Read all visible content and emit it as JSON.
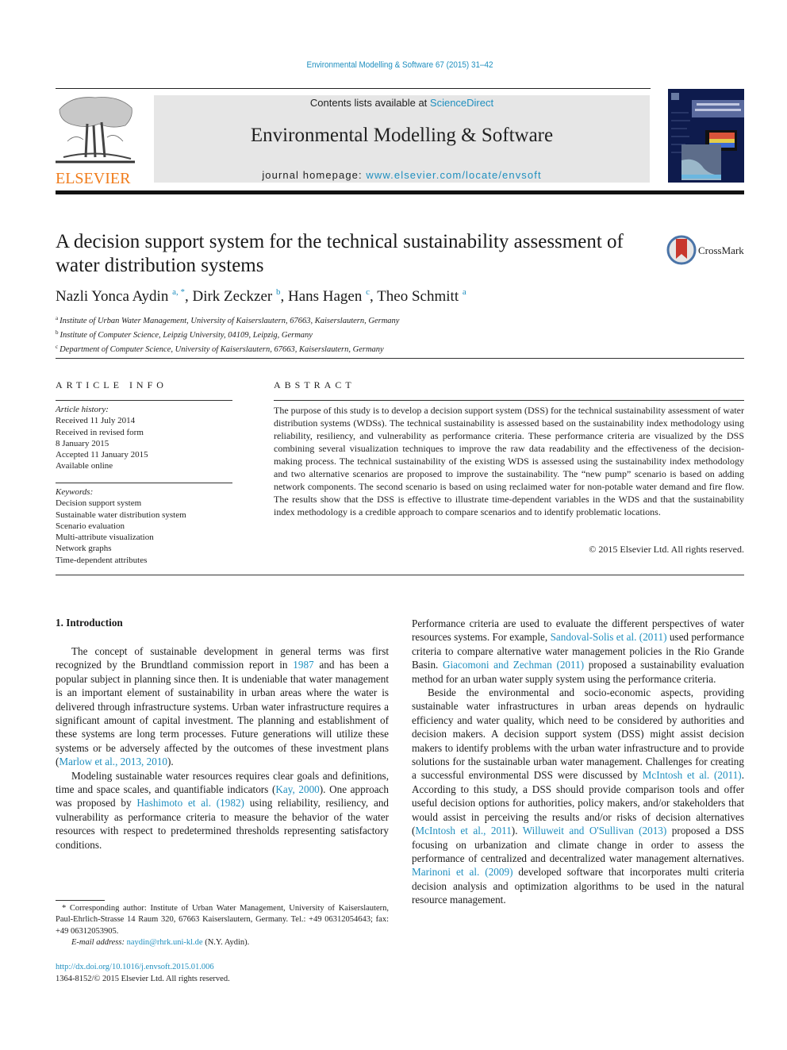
{
  "header": {
    "running_head": "Environmental Modelling & Software 67 (2015) 31–42",
    "publisher": "ELSEVIER",
    "contents_prefix": "Contents lists available at ",
    "contents_link": "ScienceDirect",
    "journal_title": "Environmental Modelling & Software",
    "homepage_prefix": "journal homepage: ",
    "homepage_link": "www.elsevier.com/locate/envsoft",
    "cover_title": "Environmental Modelling & Software",
    "colors": {
      "link": "#1f8fbf",
      "elsevier_orange": "#f07c1b",
      "banner_bg": "#e6e6e6",
      "cover_bg": "#0e1b4d"
    }
  },
  "article": {
    "title": "A decision support system for the technical sustainability assessment of water distribution systems",
    "crossmark_label": "CrossMark",
    "authors": [
      {
        "name": "Nazli Yonca Aydin",
        "sup": "a, *",
        "sep": ", "
      },
      {
        "name": "Dirk Zeckzer",
        "sup": "b",
        "sep": ", "
      },
      {
        "name": "Hans Hagen",
        "sup": "c",
        "sep": ", "
      },
      {
        "name": "Theo Schmitt",
        "sup": "a",
        "sep": ""
      }
    ],
    "affiliations": [
      {
        "key": "a",
        "text": "Institute of Urban Water Management, University of Kaiserslautern, 67663, Kaiserslautern, Germany"
      },
      {
        "key": "b",
        "text": "Institute of Computer Science, Leipzig University, 04109, Leipzig, Germany"
      },
      {
        "key": "c",
        "text": "Department of Computer Science, University of Kaiserslautern, 67663, Kaiserslautern, Germany"
      }
    ]
  },
  "article_info": {
    "heading": "ARTICLE INFO",
    "history_label": "Article history:",
    "history": [
      "Received 11 July 2014",
      "Received in revised form",
      "8 January 2015",
      "Accepted 11 January 2015",
      "Available online"
    ],
    "keywords_label": "Keywords:",
    "keywords": [
      "Decision support system",
      "Sustainable water distribution system",
      "Scenario evaluation",
      "Multi-attribute visualization",
      "Network graphs",
      "Time-dependent attributes"
    ]
  },
  "abstract": {
    "heading": "ABSTRACT",
    "text": "The purpose of this study is to develop a decision support system (DSS) for the technical sustainability assessment of water distribution systems (WDSs). The technical sustainability is assessed based on the sustainability index methodology using reliability, resiliency, and vulnerability as performance criteria. These performance criteria are visualized by the DSS combining several visualization techniques to improve the raw data readability and the effectiveness of the decision-making process. The technical sustainability of the existing WDS is assessed using the sustainability index methodology and two alternative scenarios are proposed to improve the sustainability. The “new pump” scenario is based on adding network components. The second scenario is based on using reclaimed water for non-potable water demand and fire flow. The results show that the DSS is effective to illustrate time-dependent variables in the WDS and that the sustainability index methodology is a credible approach to compare scenarios and to identify problematic locations.",
    "copyright": "© 2015 Elsevier Ltd. All rights reserved."
  },
  "body": {
    "section_heading": "1.  Introduction",
    "left_p1": {
      "t1": "The concept of sustainable development in general terms was first recognized by the Brundtland commission report in ",
      "l1": "1987",
      "t2": " and has been a popular subject in planning since then. It is undeniable that water management is an important element of sustainability in urban areas where the water is delivered through infrastructure systems. Urban water infrastructure requires a significant amount of capital investment. The planning and establishment of these systems are long term processes. Future generations will utilize these systems or be adversely affected by the outcomes of these investment plans (",
      "l2": "Marlow et al., 2013, 2010",
      "t3": ")."
    },
    "left_p2": {
      "t1": "Modeling sustainable water resources requires clear goals and definitions, time and space scales, and quantifiable indicators (",
      "l1": "Kay, 2000",
      "t2": "). One approach was proposed by ",
      "l2": "Hashimoto et al. (1982)",
      "t3": " using reliability, resiliency, and vulnerability as performance criteria to measure the behavior of the water resources with respect to predetermined thresholds representing satisfactory conditions."
    },
    "right_p1": {
      "t1": "Performance criteria are used to evaluate the different perspectives of water resources systems. For example, ",
      "l1": "Sandoval-Solis et al. (2011)",
      "t2": " used performance criteria to compare alternative water management policies in the Rio Grande Basin. ",
      "l2": "Giacomoni and Zechman (2011)",
      "t3": " proposed a sustainability evaluation method for an urban water supply system using the performance criteria."
    },
    "right_p2": {
      "t1": "Beside the environmental and socio-economic aspects, providing sustainable water infrastructures in urban areas depends on hydraulic efficiency and water quality, which need to be considered by authorities and decision makers. A decision support system (DSS) might assist decision makers to identify problems with the urban water infrastructure and to provide solutions for the sustainable urban water management. Challenges for creating a successful environmental DSS were discussed by ",
      "l1": "McIntosh et al. (2011)",
      "t2": ". According to this study, a DSS should provide comparison tools and offer useful decision options for authorities, policy makers, and/or stakeholders that would assist in perceiving the results and/or risks of decision alternatives (",
      "l2": "McIntosh et al., 2011",
      "t3": "). ",
      "l3": "Willuweit and O'Sullivan (2013)",
      "t4": " proposed a DSS focusing on urbanization and climate change in order to assess the performance of centralized and decentralized water management alternatives. ",
      "l4": "Marinoni et al. (2009)",
      "t5": " developed software that incorporates multi criteria decision analysis and optimization algorithms to be used in the natural resource management."
    }
  },
  "footnote": {
    "corresponding": "* Corresponding author: Institute of Urban Water Management, University of Kaiserslautern, Paul-Ehrlich-Strasse 14 Raum 320, 67663 Kaiserslautern, Germany. Tel.: +49 06312054643; fax: +49 06312053905.",
    "email_label": "E-mail address: ",
    "email": "naydin@rhrk.uni-kl.de",
    "email_suffix": " (N.Y. Aydin).",
    "doi": "http://dx.doi.org/10.1016/j.envsoft.2015.01.006",
    "issn": "1364-8152/© 2015 Elsevier Ltd. All rights reserved."
  }
}
